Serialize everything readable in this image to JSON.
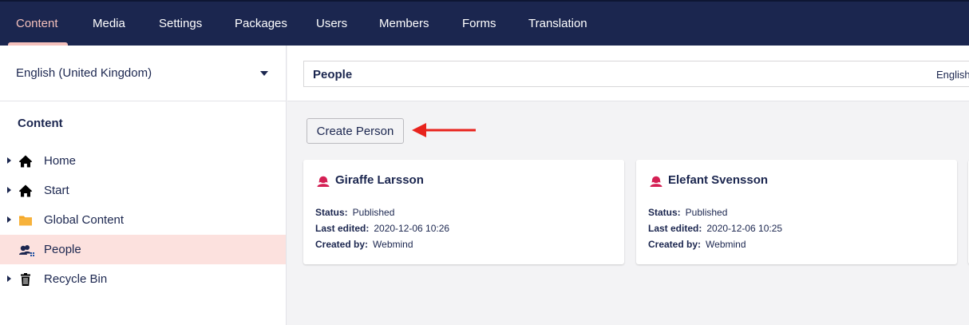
{
  "nav": {
    "items": [
      "Content",
      "Media",
      "Settings",
      "Packages",
      "Users",
      "Members",
      "Forms",
      "Translation"
    ],
    "active": "Content"
  },
  "sidebar": {
    "language": "English (United Kingdom)",
    "tree_title": "Content",
    "items": [
      {
        "label": "Home",
        "icon": "home-icon"
      },
      {
        "label": "Start",
        "icon": "home-icon"
      },
      {
        "label": "Global Content",
        "icon": "folder-icon"
      },
      {
        "label": "People",
        "icon": "users-icon"
      },
      {
        "label": "Recycle Bin",
        "icon": "trash-icon"
      }
    ]
  },
  "editor": {
    "node_name": "People",
    "variant": "English",
    "create_button": "Create Person",
    "cards": [
      {
        "name": "Giraffe Larsson",
        "status_label": "Status:",
        "status": "Published",
        "edited_label": "Last edited:",
        "edited": "2020-12-06 10:26",
        "created_label": "Created by:",
        "created_by": "Webmind"
      },
      {
        "name": "Elefant Svensson",
        "status_label": "Status:",
        "status": "Published",
        "edited_label": "Last edited:",
        "edited": "2020-12-06 10:25",
        "created_label": "Created by:",
        "created_by": "Webmind"
      }
    ]
  },
  "colors": {
    "nav_bg": "#1b264f",
    "accent": "#f5c1bc",
    "active_row": "#fce1de",
    "person_icon": "#d42054",
    "folder_icon": "#f5a623",
    "annotation_arrow": "#e8231d"
  }
}
